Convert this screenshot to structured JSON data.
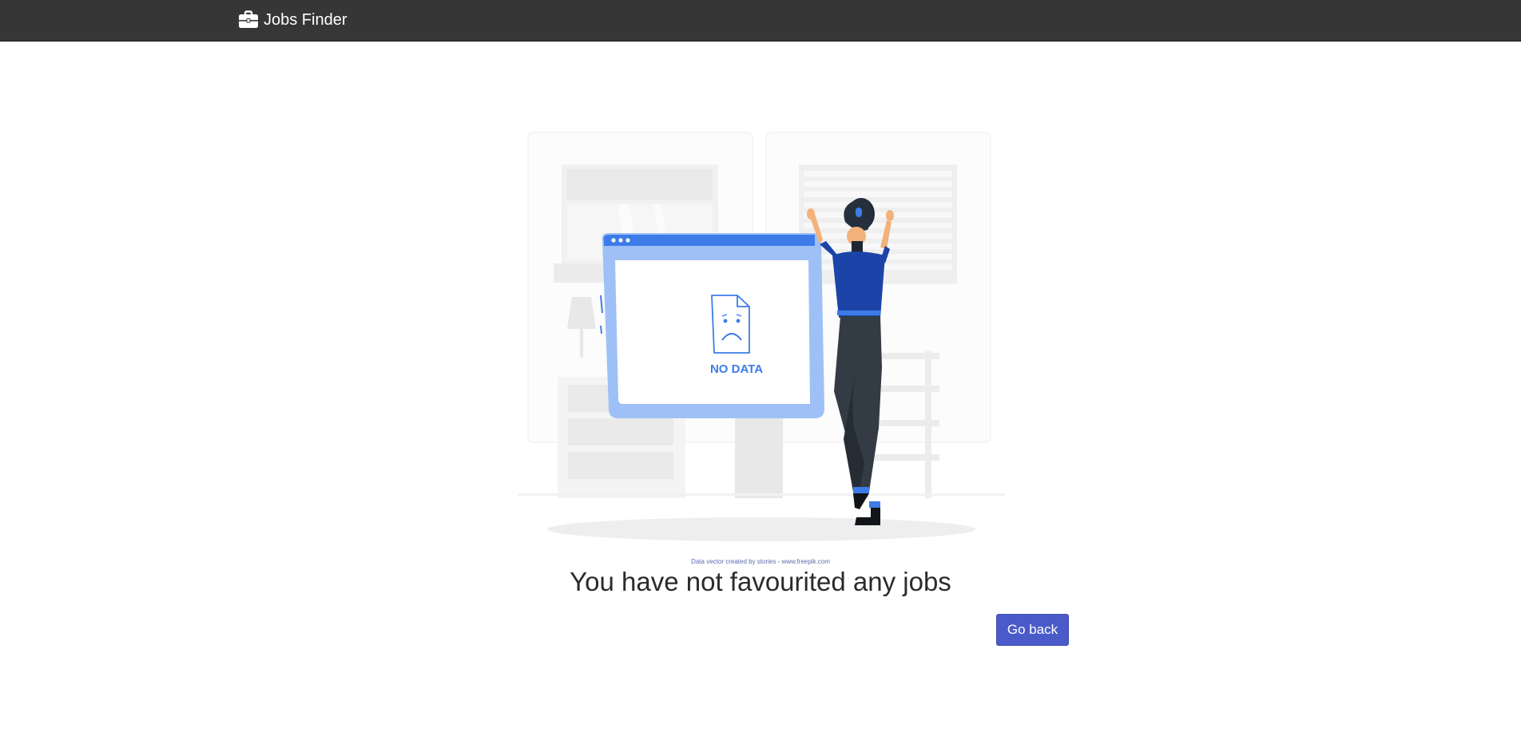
{
  "navbar": {
    "brand_icon": "briefcase-icon",
    "brand_label": "Jobs Finder",
    "background": "#363636"
  },
  "empty_state": {
    "illustration": {
      "screen_label": "NO DATA",
      "accent_color": "#4a8cf0"
    },
    "credit": "Data vector created by stories - www.freepik.com",
    "title": "You have not favourited any jobs",
    "button_label": "Go back",
    "button_color": "#4a5bc9"
  }
}
